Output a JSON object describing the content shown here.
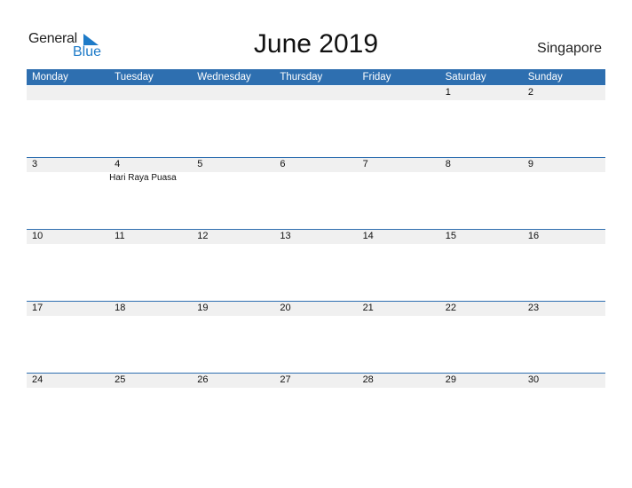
{
  "logo": {
    "general": "General",
    "blue": "Blue"
  },
  "title": "June 2019",
  "country": "Singapore",
  "colors": {
    "accent": "#2e6fb0",
    "logo_blue": "#1e7bc8",
    "strip": "#f0f0f0"
  },
  "weekdays": [
    "Monday",
    "Tuesday",
    "Wednesday",
    "Thursday",
    "Friday",
    "Saturday",
    "Sunday"
  ],
  "weeks": [
    {
      "days": [
        "",
        "",
        "",
        "",
        "",
        "1",
        "2"
      ],
      "events": [
        "",
        "",
        "",
        "",
        "",
        "",
        ""
      ]
    },
    {
      "days": [
        "3",
        "4",
        "5",
        "6",
        "7",
        "8",
        "9"
      ],
      "events": [
        "",
        "Hari Raya Puasa",
        "",
        "",
        "",
        "",
        ""
      ]
    },
    {
      "days": [
        "10",
        "11",
        "12",
        "13",
        "14",
        "15",
        "16"
      ],
      "events": [
        "",
        "",
        "",
        "",
        "",
        "",
        ""
      ]
    },
    {
      "days": [
        "17",
        "18",
        "19",
        "20",
        "21",
        "22",
        "23"
      ],
      "events": [
        "",
        "",
        "",
        "",
        "",
        "",
        ""
      ]
    },
    {
      "days": [
        "24",
        "25",
        "26",
        "27",
        "28",
        "29",
        "30"
      ],
      "events": [
        "",
        "",
        "",
        "",
        "",
        "",
        ""
      ]
    }
  ]
}
